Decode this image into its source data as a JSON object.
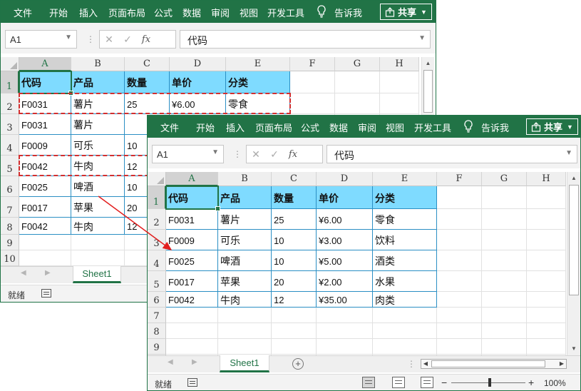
{
  "ribbon": {
    "tabs": [
      "文件",
      "开始",
      "插入",
      "页面布局",
      "公式",
      "数据",
      "审阅",
      "视图",
      "开发工具"
    ],
    "tell_me": "告诉我",
    "share": "共享"
  },
  "formula_bar": {
    "name_box": "A1",
    "formula": "代码",
    "cancel_icon": "✕",
    "enter_icon": "✓",
    "fx_label": "fx",
    "more": "⋮"
  },
  "columns": [
    "A",
    "B",
    "C",
    "D",
    "E",
    "F",
    "G",
    "H"
  ],
  "rows": [
    "1",
    "2",
    "3",
    "4",
    "5",
    "6",
    "7",
    "8",
    "9",
    "10"
  ],
  "headers": [
    "代码",
    "产品",
    "数量",
    "单价",
    "分类"
  ],
  "back_window": {
    "data": [
      [
        "F0031",
        "薯片",
        "25",
        "¥6.00",
        "零食"
      ],
      [
        "F0031",
        "薯片",
        "",
        "",
        ""
      ],
      [
        "F0009",
        "可乐",
        "10",
        "",
        ""
      ],
      [
        "F0042",
        "牛肉",
        "12",
        "",
        ""
      ],
      [
        "F0025",
        "啤酒",
        "10",
        "",
        ""
      ],
      [
        "F0017",
        "苹果",
        "20",
        "",
        ""
      ],
      [
        "F0042",
        "牛肉",
        "12",
        "",
        ""
      ]
    ],
    "sheet_tab": "Sheet1",
    "status": "就绪"
  },
  "front_window": {
    "data": [
      [
        "F0031",
        "薯片",
        "25",
        "¥6.00",
        "零食"
      ],
      [
        "F0009",
        "可乐",
        "10",
        "¥3.00",
        "饮料"
      ],
      [
        "F0025",
        "啤酒",
        "10",
        "¥5.00",
        "酒类"
      ],
      [
        "F0017",
        "苹果",
        "20",
        "¥2.00",
        "水果"
      ],
      [
        "F0042",
        "牛肉",
        "12",
        "¥35.00",
        "肉类"
      ]
    ],
    "sheet_tab": "Sheet1",
    "status": "就绪",
    "zoom": "100%"
  },
  "colors": {
    "ribbon": "#217346",
    "header_fill": "#7fdbff",
    "table_border": "#2b8fc4",
    "marquee": "#d32f2f"
  },
  "icons": [
    "lightbulb-icon",
    "share-icon",
    "macro-record-icon",
    "normal-view-icon",
    "page-layout-icon",
    "page-break-icon",
    "add-sheet-icon",
    "arrow-icon"
  ]
}
